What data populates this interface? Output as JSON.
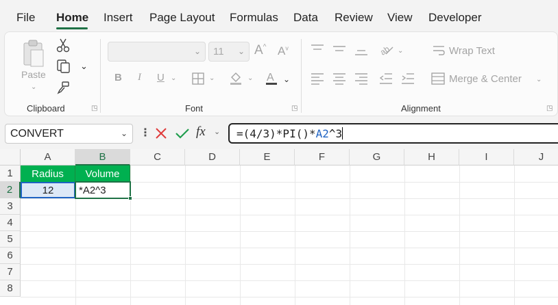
{
  "menu": {
    "tabs": [
      {
        "label": "File"
      },
      {
        "label": "Home"
      },
      {
        "label": "Insert"
      },
      {
        "label": "Page Layout"
      },
      {
        "label": "Formulas"
      },
      {
        "label": "Data"
      },
      {
        "label": "Review"
      },
      {
        "label": "View"
      },
      {
        "label": "Developer"
      }
    ],
    "active": "Home"
  },
  "ribbon": {
    "clipboard": {
      "label": "Clipboard",
      "paste_label": "Paste"
    },
    "font": {
      "label": "Font",
      "font_name": "",
      "font_size": "11"
    },
    "alignment": {
      "label": "Alignment",
      "wrap_text": "Wrap Text",
      "merge_center": "Merge & Center"
    }
  },
  "formula_bar": {
    "name_box": "CONVERT",
    "fx_label": "fx",
    "formula_prefix": "=(4/3)*PI()*",
    "formula_ref": "A2",
    "formula_suffix": "^3"
  },
  "grid": {
    "columns": [
      "A",
      "B",
      "C",
      "D",
      "E",
      "F",
      "G",
      "H",
      "I",
      "J"
    ],
    "rows": [
      "1",
      "2",
      "3",
      "4",
      "5",
      "6",
      "7",
      "8"
    ],
    "cells": {
      "A1": "Radius",
      "B1": "Volume",
      "A2": "12",
      "B2": "*A2^3"
    }
  },
  "colors": {
    "accent": "#1e7145",
    "header_fill": "#00b050",
    "reference": "#1f63c3"
  }
}
